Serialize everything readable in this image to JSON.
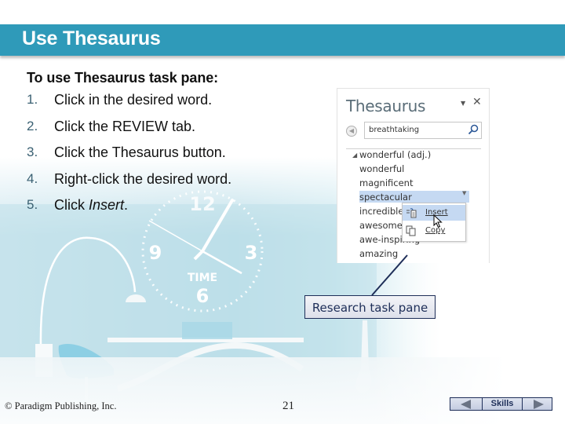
{
  "slide": {
    "title": "Use Thesaurus",
    "instructions": {
      "heading": "To use Thesaurus task pane:",
      "steps": [
        {
          "num": "1.",
          "text": "Click in the desired word."
        },
        {
          "num": "2.",
          "text": "Click the REVIEW tab."
        },
        {
          "num": "3.",
          "text": "Click the Thesaurus button."
        },
        {
          "num": "4.",
          "text": "Right-click the desired word."
        },
        {
          "num": "5.",
          "text_prefix": "Click ",
          "text_em": "Insert",
          "text_suffix": "."
        }
      ]
    }
  },
  "thesaurus_pane": {
    "title": "Thesaurus",
    "menu_icon": "dropdown-triangle-icon",
    "close_icon": "close-x-icon",
    "back_icon": "back-arrow-icon",
    "search_value": "breathtaking",
    "search_icon": "magnifier-icon",
    "group_caret": "◢",
    "group_label": "wonderful (adj.)",
    "items": [
      "wonderful",
      "magnificent",
      "spectacular",
      "incredible",
      "awesome",
      "awe-inspiring",
      "amazing"
    ],
    "selected_item": "spectacular",
    "context_menu": {
      "items": [
        {
          "label": "Insert",
          "icon": "insert-icon",
          "hover": true
        },
        {
          "label": "Copy",
          "icon": "copy-icon",
          "hover": false
        }
      ]
    }
  },
  "background": {
    "clock_numbers": [
      "12",
      "9",
      "3",
      "6"
    ],
    "clock_label": "TIME"
  },
  "callout": {
    "label": "Research task pane"
  },
  "footer": {
    "copyright": "© Paradigm Publishing, Inc.",
    "page_number": "21",
    "nav": {
      "prev_icon": "previous-triangle-icon",
      "label": "Skills",
      "next_icon": "next-triangle-icon"
    }
  },
  "colors": {
    "title_bar": "#2f9ab9",
    "title_text": "#ffffff",
    "callout_border": "#1e2e58",
    "selection": "#c5d9f2"
  }
}
